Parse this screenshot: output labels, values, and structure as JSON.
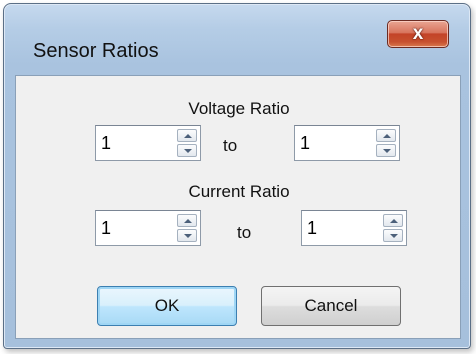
{
  "window": {
    "title": "Sensor Ratios",
    "close_glyph": "x"
  },
  "voltage": {
    "label": "Voltage Ratio",
    "from_value": "1",
    "to_label": "to",
    "to_value": "1"
  },
  "current": {
    "label": "Current Ratio",
    "from_value": "1",
    "to_label": "to",
    "to_value": "1"
  },
  "buttons": {
    "ok_label": "OK",
    "cancel_label": "Cancel"
  },
  "icons": {
    "close": "close-icon",
    "spin_up": "chevron-up-icon",
    "spin_down": "chevron-down-icon"
  },
  "colors": {
    "close_button": "#c7512f",
    "default_button_focus": "#3c7fb1",
    "frame": "#b5cde6"
  }
}
